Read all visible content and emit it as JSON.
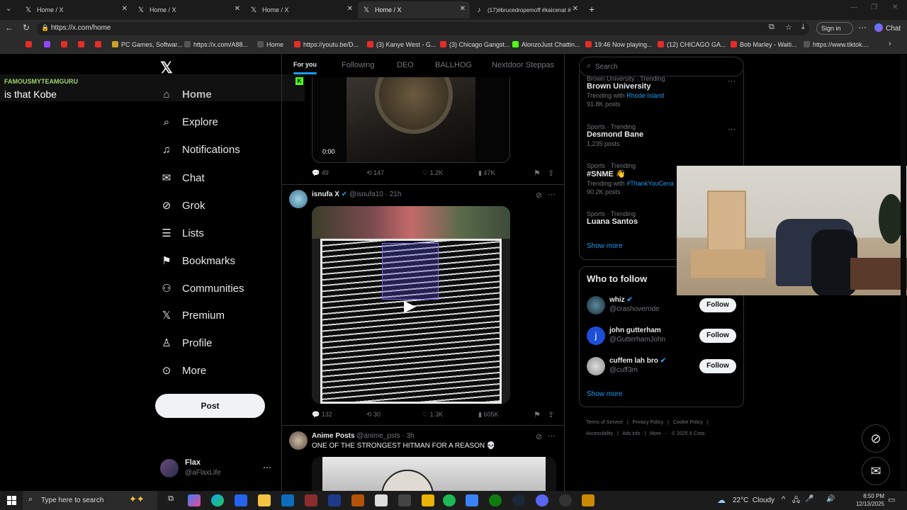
{
  "browser": {
    "tabs": [
      {
        "title": "Home / X"
      },
      {
        "title": "Home / X"
      },
      {
        "title": "Home / X"
      },
      {
        "title": "Home / X"
      },
      {
        "title": "(17)#brucedropemoff #kaicenat #"
      }
    ],
    "url": "https://x.com/home",
    "sign_in": "Sign in",
    "chat": "Chat",
    "bookmarks": [
      "PC Games, Softwar...",
      "https://x.com/A88...",
      "Home",
      "https://youtu.be/D...",
      "(3) Kanye West - G...",
      "(3) Chicago Gangst...",
      "AlonzoJust Chattin...",
      "19:46 Now playing...",
      "(12) CHICAGO GA...",
      "Bob Marley - Waiti...",
      "https://www.tiktok...."
    ]
  },
  "overlay": {
    "user": "FAMOUSMYTEAMGURU",
    "message": "is that Kobe"
  },
  "sidebar": {
    "items": [
      {
        "label": "Home",
        "icon": "home-icon"
      },
      {
        "label": "Explore",
        "icon": "search-icon"
      },
      {
        "label": "Notifications",
        "icon": "bell-icon"
      },
      {
        "label": "Chat",
        "icon": "mail-icon"
      },
      {
        "label": "Grok",
        "icon": "grok-icon"
      },
      {
        "label": "Lists",
        "icon": "list-icon"
      },
      {
        "label": "Bookmarks",
        "icon": "bookmark-icon"
      },
      {
        "label": "Communities",
        "icon": "communities-icon"
      },
      {
        "label": "Premium",
        "icon": "x-icon"
      },
      {
        "label": "Profile",
        "icon": "person-icon"
      },
      {
        "label": "More",
        "icon": "more-icon"
      }
    ],
    "post_button": "Post",
    "account": {
      "name": "Flax",
      "handle": "@aFlaxLife"
    }
  },
  "feed": {
    "tabs": [
      "For you",
      "Following",
      "DEO",
      "BALLHOG",
      "Nextdoor Steppas"
    ],
    "video_time": "0:00",
    "post1_actions": {
      "replies": "49",
      "reposts": "147",
      "likes": "1.2K",
      "views": "47K"
    },
    "post2": {
      "name": "isnufa X",
      "handle": "@isnufa10 · 21h",
      "replies": "132",
      "reposts": "30",
      "likes": "1.3K",
      "views": "605K"
    },
    "post3": {
      "name": "Anime Posts",
      "handle": "@anime_psts · 3h",
      "text": "ONE OF THE STRONGEST HITMAN FOR A REASON 💀"
    }
  },
  "right": {
    "search_placeholder": "Search",
    "trends": [
      {
        "meta": "Brown University · Trending",
        "title": "Brown University",
        "extra": "Trending with",
        "link": "Rhode Island",
        "posts": "91.8K posts"
      },
      {
        "meta": "Sports · Trending",
        "title": "Desmond Bane",
        "posts": "1,235 posts"
      },
      {
        "meta": "Sports · Trending",
        "title": "#SNME 👋",
        "extra": "Trending with",
        "link": "#ThankYouCena",
        "posts": "90.2K posts"
      },
      {
        "meta": "Sports · Trending",
        "title": "Luana Santos"
      }
    ],
    "show_more": "Show more",
    "who_to_follow": "Who to follow",
    "follows": [
      {
        "name": "whiz",
        "handle": "@crashoverride",
        "btn": "Follow"
      },
      {
        "name": "john gutterham",
        "handle": "@GutterhamJohn",
        "btn": "Follow"
      },
      {
        "name": "cuffem lah bro",
        "handle": "@cuff3m",
        "btn": "Follow"
      }
    ],
    "show_more2": "Show more",
    "footer1": [
      "Terms of Service",
      "|",
      "Privacy Policy",
      "|",
      "Cookie Policy",
      "|"
    ],
    "footer2": [
      "Accessibility",
      "|",
      "Ads info",
      "|",
      "More ···",
      "© 2025 X Corp."
    ]
  },
  "taskbar": {
    "search": "Type here to search",
    "weather": "22°C  Cloudy",
    "time": "8:50 PM",
    "date": "12/13/2025"
  }
}
